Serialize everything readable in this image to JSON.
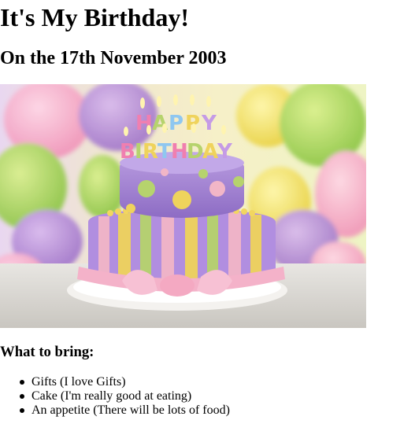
{
  "page": {
    "title": "It's My Birthday!",
    "subtitle": "On the 17th November 2003",
    "section_heading": "What to bring:",
    "bring_items": [
      "Gifts (I love Gifts)",
      "Cake (I'm really good at eating)",
      "An appetite (There will be lots of food)"
    ]
  },
  "photo": {
    "candle_word_top": "HAPPY",
    "candle_word_bottom": "BIRTHDAY"
  }
}
